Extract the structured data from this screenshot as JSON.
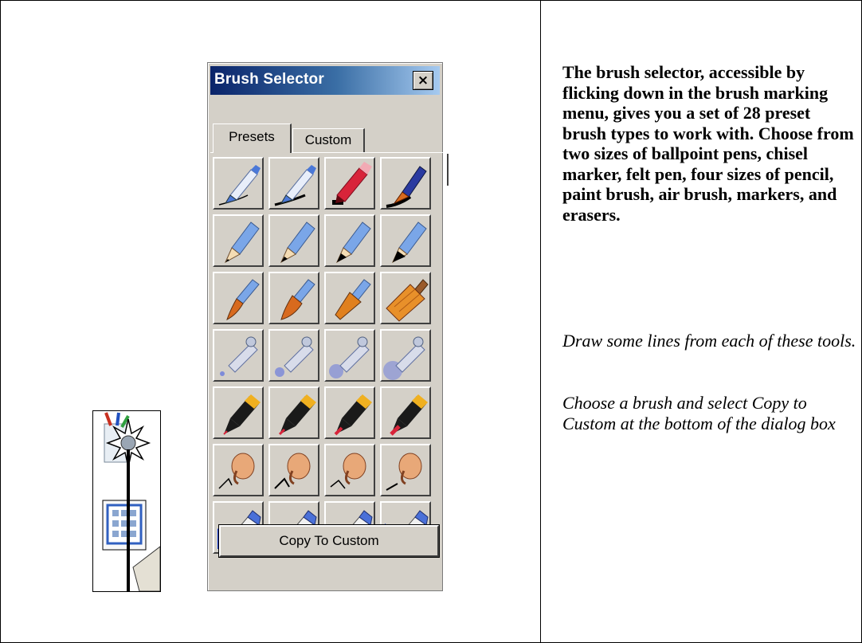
{
  "window": {
    "title": "Brush Selector",
    "close_glyph": "×",
    "tabs": [
      {
        "label": "Presets",
        "selected": true
      },
      {
        "label": "Custom",
        "selected": false
      }
    ],
    "copy_button": "Copy To Custom",
    "brush_rows": [
      {
        "tool": "ballpoint-pen",
        "count": 2
      },
      {
        "tool": "chisel-marker",
        "count": 1
      },
      {
        "tool": "felt-pen",
        "count": 1
      },
      {
        "tool": "pencil",
        "count": 4
      },
      {
        "tool": "paint-brush",
        "count": 4
      },
      {
        "tool": "air-brush",
        "count": 4
      },
      {
        "tool": "marker",
        "count": 4
      },
      {
        "tool": "smudge",
        "count": 4
      },
      {
        "tool": "eraser",
        "count": 4
      }
    ]
  },
  "description": {
    "paragraph": "The brush selector, accessible by flicking down in the brush marking menu, gives you a set of 28 preset brush types to work with. Choose from two sizes of ballpoint pens, chisel marker, felt pen, four sizes of pencil, paint brush, air brush, markers, and erasers.",
    "instruction_1": "Draw some lines from each of these tools.",
    "instruction_2": "Choose a brush and select Copy to Custom at the bottom of the dialog box"
  },
  "colors": {
    "title_bar_start": "#0a246a",
    "title_bar_end": "#a6caf0",
    "dialog_face": "#d4d0c8",
    "pen_blue": "#4a78d8",
    "marker_red": "#d8243a",
    "brush_orange": "#d86a1e",
    "airbrush_blue": "#5a6ee0",
    "marker_yellow": "#f0b020",
    "eraser_blue": "#0a3ad8"
  }
}
